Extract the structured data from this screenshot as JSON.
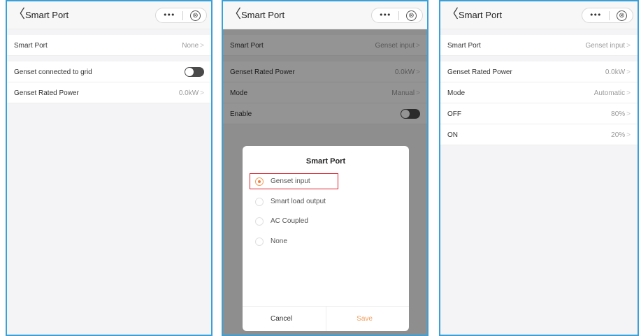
{
  "screens": [
    {
      "header": {
        "title": "Smart Port",
        "back_glyph": "〈",
        "more_glyph": "•••",
        "close_glyph": "⊗"
      },
      "rows": [
        {
          "label": "Smart Port",
          "value": "None",
          "chevron": ">"
        },
        {
          "label": "Genset connected to grid",
          "toggle": "off"
        },
        {
          "label": "Genset Rated Power",
          "value": "0.0kW",
          "chevron": ">"
        }
      ]
    },
    {
      "header": {
        "title": "Smart Port",
        "back_glyph": "〈",
        "more_glyph": "•••",
        "close_glyph": "⊗"
      },
      "rows": [
        {
          "label": "Smart Port",
          "value": "Genset input",
          "chevron": ">"
        },
        {
          "label": "Genset Rated Power",
          "value": "0.0kW",
          "chevron": ">"
        },
        {
          "label": "Mode",
          "value": "Manual",
          "chevron": ">"
        },
        {
          "label": "Enable",
          "toggle": "off"
        }
      ],
      "dialog": {
        "title": "Smart Port",
        "options": [
          "Genset input",
          "Smart load output",
          "AC Coupled",
          "None"
        ],
        "selected": "Genset input",
        "cancel": "Cancel",
        "save": "Save"
      }
    },
    {
      "header": {
        "title": "Smart Port",
        "back_glyph": "〈",
        "more_glyph": "•••",
        "close_glyph": "⊗"
      },
      "rows": [
        {
          "label": "Smart Port",
          "value": "Genset input",
          "chevron": ">"
        },
        {
          "label": "Genset Rated Power",
          "value": "0.0kW",
          "chevron": ">"
        },
        {
          "label": "Mode",
          "value": "Automatic",
          "chevron": ">"
        },
        {
          "label": "OFF",
          "value": "80%",
          "chevron": ">"
        },
        {
          "label": "ON",
          "value": "20%",
          "chevron": ">"
        }
      ]
    }
  ],
  "colors": {
    "frame_border": "#3aa0d8",
    "accent": "#f0a060",
    "highlight": "#d9232e"
  }
}
